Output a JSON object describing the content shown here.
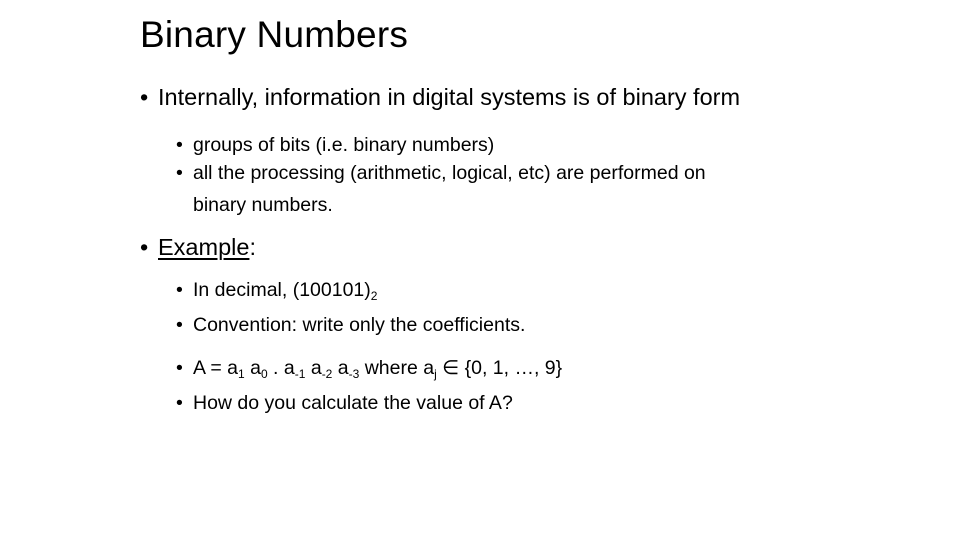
{
  "slide": {
    "title": "Binary Numbers",
    "bullets": {
      "b1": "Internally, information in digital systems is of binary form",
      "b1_sub1": "groups of bits (i.e. binary numbers)",
      "b1_sub2_line1": "all the processing (arithmetic, logical, etc) are performed on",
      "b1_sub2_line2": "binary numbers.",
      "b2_label": "Example",
      "b2_colon": ":",
      "b2_sub1_text": "In decimal, (100101)",
      "b2_sub1_subscript": "2",
      "b2_sub2": "Convention: write only the coefficients.",
      "b2_sub3": {
        "prefix": "A = a",
        "s1": "1",
        "t1": " a",
        "s2": "0",
        "t2": " . a",
        "s3": "-1",
        "t3": " a",
        "s4": "-2",
        "t4": " a",
        "s5": "-3",
        "t5": " where a",
        "s6": "j",
        "t6": " ∈ {0, 1, …, 9}"
      },
      "b2_sub4": "How do you calculate the value of A?"
    },
    "bullet_glyph": "•"
  }
}
